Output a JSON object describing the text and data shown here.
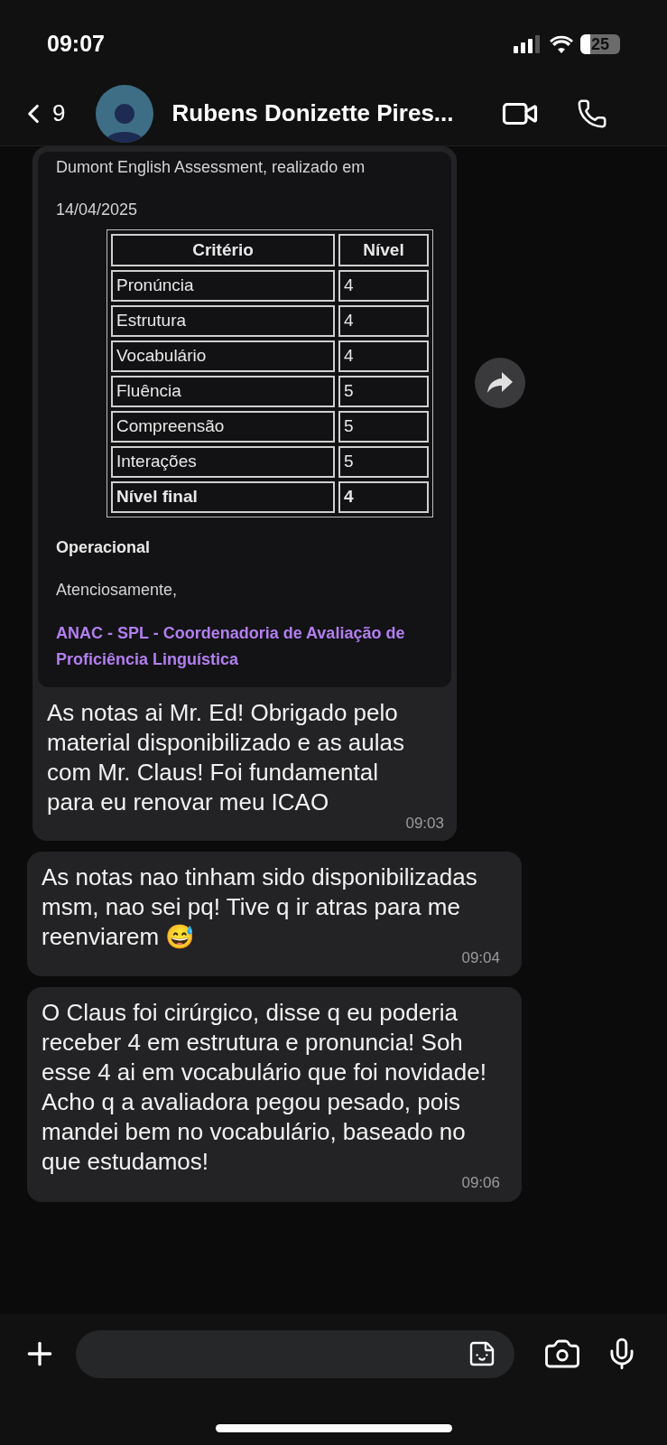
{
  "status_bar": {
    "time": "09:07",
    "battery": "25"
  },
  "header": {
    "back_count": "9",
    "contact_name": "Rubens Donizette Pires..."
  },
  "messages": [
    {
      "kind": "document",
      "lines": [
        "Dumont English Assessment, realizado em",
        "14/04/2025"
      ],
      "table": {
        "columns": [
          "Critério",
          "Nível"
        ],
        "rows": [
          {
            "cells": [
              "Pronúncia",
              "4"
            ],
            "bold": false
          },
          {
            "cells": [
              "Estrutura",
              "4"
            ],
            "bold": false
          },
          {
            "cells": [
              "Vocabulário",
              "4"
            ],
            "bold": false
          },
          {
            "cells": [
              "Fluência",
              "5"
            ],
            "bold": false
          },
          {
            "cells": [
              "Compreensão",
              "5"
            ],
            "bold": false
          },
          {
            "cells": [
              "Interações",
              "5"
            ],
            "bold": false
          },
          {
            "cells": [
              "Nível final",
              "4"
            ],
            "bold": true
          }
        ]
      },
      "after": [
        {
          "kind": "bold",
          "text": "Operacional"
        },
        {
          "kind": "plain",
          "text": "Atenciosamente,"
        },
        {
          "kind": "link",
          "text": "ANAC - SPL - Coordenadoria de Avaliação de Proficiência Linguística"
        }
      ],
      "caption": "As notas ai Mr. Ed! Obrigado pelo material disponibilizado e as aulas com Mr. Claus! Foi fundamental para eu renovar meu ICAO",
      "time": "09:03"
    },
    {
      "kind": "text",
      "text": "As notas nao tinham sido disponibilizadas msm, nao sei pq! Tive q ir atras para me reenviarem 😅",
      "time": "09:04"
    },
    {
      "kind": "text",
      "text": "O Claus foi cirúrgico, disse q eu poderia receber 4 em estrutura e pronuncia! Soh esse 4 ai em vocabulário que foi novidade! Acho q a avaliadora pegou pesado, pois mandei bem no vocabulário, baseado no que estudamos!",
      "time": "09:06"
    }
  ]
}
